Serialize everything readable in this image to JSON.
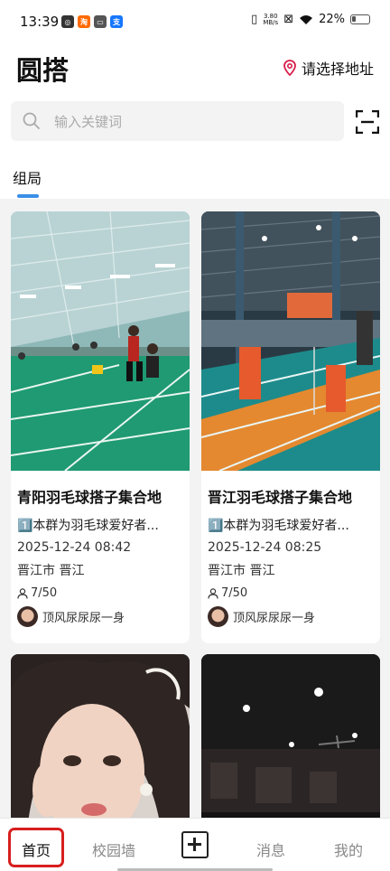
{
  "status_bar": {
    "time": "13:39",
    "speed_value": "3.80",
    "speed_unit": "MB/s",
    "battery": "22%"
  },
  "header": {
    "title": "圆搭",
    "location": "请选择地址",
    "search_placeholder": "输入关键词"
  },
  "tabs": {
    "active": "组局"
  },
  "cards": [
    {
      "title": "青阳羽毛球搭子集合地",
      "desc": "1️⃣本群为羽毛球爱好者...",
      "time": "2025-12-24 08:42",
      "location": "晋江市 晋江",
      "count": "7/50",
      "user": "顶风尿尿尿一身"
    },
    {
      "title": "晋江羽毛球搭子集合地",
      "desc": "1️⃣本群为羽毛球爱好者...",
      "time": "2025-12-24 08:25",
      "location": "晋江市 晋江",
      "count": "7/50",
      "user": "顶风尿尿尿一身"
    }
  ],
  "tabbar": {
    "home": "首页",
    "campus": "校园墙",
    "messages": "消息",
    "mine": "我的"
  },
  "colors": {
    "accent": "#3a8ee6",
    "highlight": "#d81e1e"
  }
}
